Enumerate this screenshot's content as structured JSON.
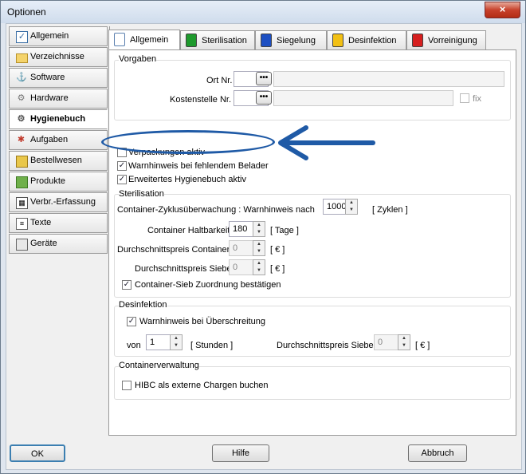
{
  "window": {
    "title": "Optionen",
    "close_glyph": "×"
  },
  "nav": {
    "items": [
      {
        "label": "Allgemein",
        "icon": "checklist-icon"
      },
      {
        "label": "Verzeichnisse",
        "icon": "folder-icon"
      },
      {
        "label": "Software",
        "icon": "software-icon"
      },
      {
        "label": "Hardware",
        "icon": "gear-icon"
      },
      {
        "label": "Hygienebuch",
        "icon": "gear-icon",
        "active": true
      },
      {
        "label": "Aufgaben",
        "icon": "task-icon"
      },
      {
        "label": "Bestellwesen",
        "icon": "order-icon"
      },
      {
        "label": "Produkte",
        "icon": "product-icon"
      },
      {
        "label": "Verbr.-Erfassung",
        "icon": "consumption-icon"
      },
      {
        "label": "Texte",
        "icon": "text-icon"
      },
      {
        "label": "Geräte",
        "icon": "device-icon"
      }
    ]
  },
  "tabs": [
    {
      "label": "Allgemein",
      "color": "#ffffff",
      "active": true
    },
    {
      "label": "Sterilisation",
      "color": "#1e9a2d"
    },
    {
      "label": "Siegelung",
      "color": "#1d4fc2"
    },
    {
      "label": "Desinfektion",
      "color": "#f2c014"
    },
    {
      "label": "Vorreinigung",
      "color": "#d61f1f"
    }
  ],
  "vorgaben": {
    "title": "Vorgaben",
    "ort_label": "Ort Nr.",
    "ort_value": "",
    "kostenstelle_label": "Kostenstelle Nr.",
    "kostenstelle_value": "",
    "fix_label": "fix",
    "dots": "•••"
  },
  "checks": {
    "verpackungen": "Verpackungen aktiv",
    "warnhinweis_belader": "Warnhinweis bei fehlendem Belader",
    "hygienebuch": "Erweitertes Hygienebuch aktiv"
  },
  "sterilisation": {
    "title": "Sterilisation",
    "zyklus_label": "Container-Zyklusüberwachung : Warnhinweis nach",
    "zyklus_value": "1000",
    "zyklus_unit": "[ Zyklen ]",
    "haltbarkeit_label": "Container Haltbarkeit",
    "haltbarkeit_value": "180",
    "haltbarkeit_unit": "[ Tage ]",
    "preis_container_label": "Durchschnittspreis Container",
    "preis_container_value": "0",
    "preis_container_unit": "[ € ]",
    "preis_siebe_label": "Durchschnittspreis Siebe",
    "preis_siebe_value": "0",
    "preis_siebe_unit": "[ € ]",
    "zuordnung_label": "Container-Sieb Zuordnung bestätigen"
  },
  "desinfektion": {
    "title": "Desinfektion",
    "warn_label": "Warnhinweis bei Überschreitung",
    "von_label": "von",
    "von_value": "1",
    "stunden_unit": "[ Stunden ]",
    "preis_siebe_label": "Durchschnittspreis Siebe",
    "preis_siebe_value": "0",
    "preis_siebe_unit": "[ € ]"
  },
  "containerverwaltung": {
    "title": "Containerverwaltung",
    "hibc_label": "HIBC als externe Chargen buchen"
  },
  "buttons": {
    "ok": "OK",
    "hilfe": "Hilfe",
    "abbruch": "Abbruch"
  },
  "annotation": {
    "color": "#1f5aa6"
  }
}
